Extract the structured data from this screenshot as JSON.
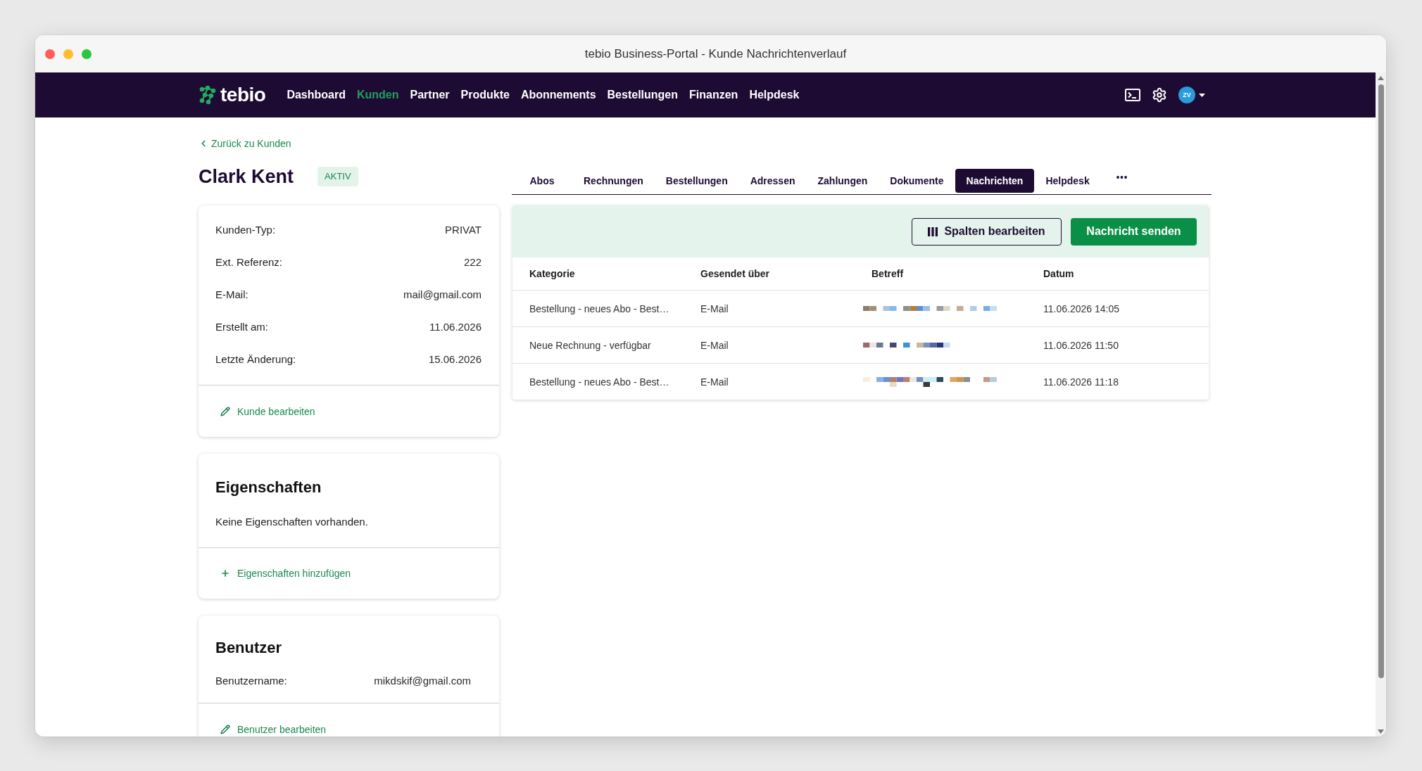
{
  "window": {
    "title": "tebio Business-Portal - Kunde Nachrichtenverlauf"
  },
  "navbar": {
    "logo": "tebio",
    "items": [
      {
        "label": "Dashboard",
        "selected": false
      },
      {
        "label": "Kunden",
        "selected": true
      },
      {
        "label": "Partner",
        "selected": false
      },
      {
        "label": "Produkte",
        "selected": false
      },
      {
        "label": "Abonnements",
        "selected": false
      },
      {
        "label": "Bestellungen",
        "selected": false
      },
      {
        "label": "Finanzen",
        "selected": false
      },
      {
        "label": "Helpdesk",
        "selected": false
      }
    ],
    "user": {
      "initials": "ZV"
    }
  },
  "customer": {
    "back_link": "Zurück zu Kunden",
    "name": "Clark Kent",
    "status": "AKTIV",
    "details": {
      "fields": [
        {
          "label": "Kunden-Typ:",
          "value": "PRIVAT"
        },
        {
          "label": "Ext. Referenz:",
          "value": "222"
        },
        {
          "label": "E-Mail:",
          "value": "mail@gmail.com"
        },
        {
          "label": "Erstellt am:",
          "value": "11.06.2026"
        },
        {
          "label": "Letzte Änderung:",
          "value": "15.06.2026"
        }
      ],
      "action": "Kunde bearbeiten"
    },
    "properties": {
      "title": "Eigenschaften",
      "empty_text": "Keine Eigenschaften vorhanden.",
      "action": "Eigenschaften hinzufügen"
    },
    "user_account": {
      "title": "Benutzer",
      "fields": [
        {
          "label": "Benutzername:",
          "value": "mikdskif@gmail.com"
        }
      ],
      "action": "Benutzer bearbeiten"
    }
  },
  "tabs": [
    {
      "label": "Abos",
      "selected": false
    },
    {
      "label": "Rechnungen",
      "selected": false
    },
    {
      "label": "Bestellungen",
      "selected": false
    },
    {
      "label": "Adressen",
      "selected": false
    },
    {
      "label": "Zahlungen",
      "selected": false
    },
    {
      "label": "Dokumente",
      "selected": false
    },
    {
      "label": "Nachrichten",
      "selected": true
    },
    {
      "label": "Helpdesk",
      "selected": false
    }
  ],
  "messages": {
    "toolbar_buttons": [
      {
        "label": "Spalten bearbeiten",
        "kind": "outline"
      },
      {
        "label": "Nachricht senden",
        "kind": "primary"
      }
    ],
    "table": {
      "columns": [
        "Kategorie",
        "Gesendet über",
        "Betreff",
        "Datum"
      ],
      "rows": [
        {
          "category": "Bestellung - neues Abo - Best…",
          "channel": "E-Mail",
          "subject_pixelated": true,
          "date": "11.06.2026 14:05"
        },
        {
          "category": "Neue Rechnung - verfügbar",
          "channel": "E-Mail",
          "subject_pixelated": true,
          "date": "11.06.2026 11:50"
        },
        {
          "category": "Bestellung - neues Abo - Best…",
          "channel": "E-Mail",
          "subject_pixelated": true,
          "date": "11.06.2026 11:18"
        }
      ]
    }
  }
}
